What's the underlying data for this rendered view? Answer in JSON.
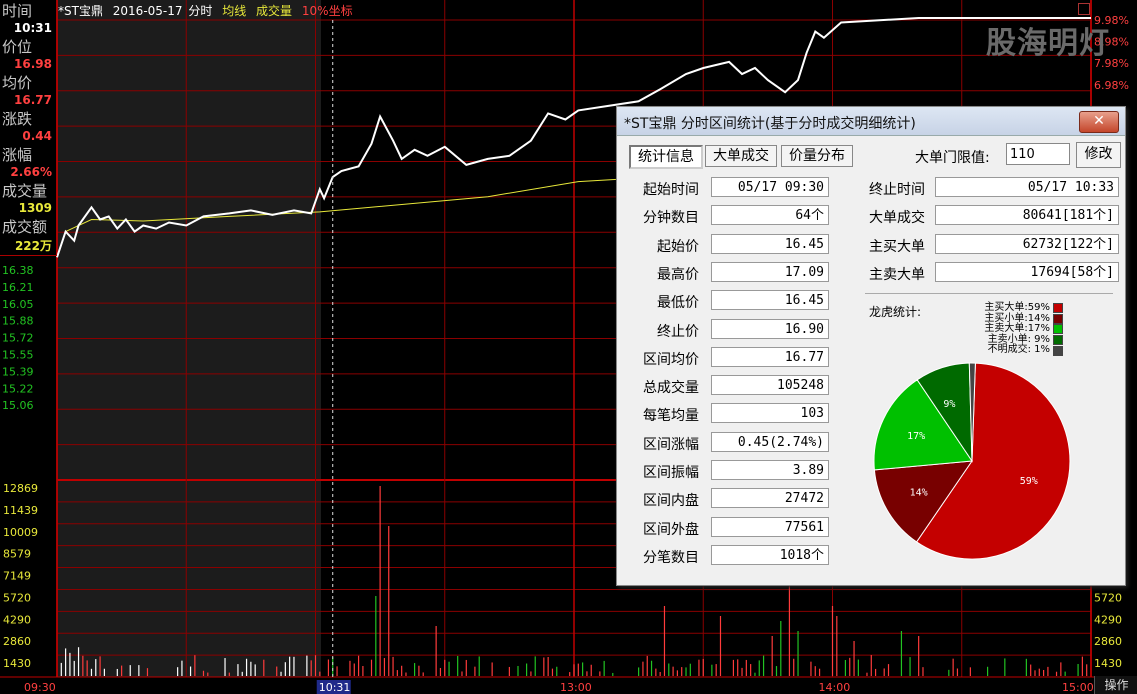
{
  "info_panel": {
    "time_label": "时间",
    "time_value": "10:31",
    "price_label": "价位",
    "price_value": "16.98",
    "avg_label": "均价",
    "avg_value": "16.77",
    "change_label": "涨跌",
    "change_value": "0.44",
    "pct_label": "涨幅",
    "pct_value": "2.66%",
    "vol_label": "成交量",
    "vol_value": "1309",
    "amount_label": "成交额",
    "amount_value": "222万"
  },
  "header": {
    "stock": "*ST宝鼎",
    "date": "2016-05-17",
    "mode": "分时",
    "avg_line": "均线",
    "volume": "成交量",
    "coord": "10%坐标"
  },
  "watermark": "股海明灯",
  "footer": {
    "operate_button": "操作"
  },
  "colors": {
    "up": "#ff3b3b",
    "down": "#22c322",
    "grid": "#8a0000",
    "avg": "#e8e83a",
    "price": "#ffffff"
  },
  "chart_data": {
    "type": "line",
    "title": "*ST宝鼎 2016-05-17 分时",
    "price_ticks_left": [
      "16.38",
      "16.21",
      "16.05",
      "15.88",
      "15.72",
      "15.55",
      "15.39",
      "15.22",
      "15.06"
    ],
    "price_ticks_right": [
      "9.98%",
      "8.98%",
      "7.98%",
      "6.98%"
    ],
    "volume_ticks": [
      "12869",
      "11439",
      "10009",
      "8579",
      "7149",
      "5720",
      "4290",
      "2860",
      "1430"
    ],
    "time_ticks": [
      "09:30",
      "10:31",
      "13:00",
      "14:00",
      "15:00"
    ],
    "ylim": [
      14.98,
      18.03
    ],
    "cursor_time": "10:31",
    "price_series": [
      {
        "t": 0,
        "p": 16.45
      },
      {
        "t": 2,
        "p": 16.62
      },
      {
        "t": 4,
        "p": 16.56
      },
      {
        "t": 5,
        "p": 16.66
      },
      {
        "t": 8,
        "p": 16.78
      },
      {
        "t": 10,
        "p": 16.7
      },
      {
        "t": 12,
        "p": 16.72
      },
      {
        "t": 14,
        "p": 16.64
      },
      {
        "t": 16,
        "p": 16.7
      },
      {
        "t": 18,
        "p": 16.62
      },
      {
        "t": 20,
        "p": 16.66
      },
      {
        "t": 23,
        "p": 16.64
      },
      {
        "t": 26,
        "p": 16.68
      },
      {
        "t": 30,
        "p": 16.66
      },
      {
        "t": 34,
        "p": 16.72
      },
      {
        "t": 40,
        "p": 16.74
      },
      {
        "t": 45,
        "p": 16.76
      },
      {
        "t": 50,
        "p": 16.73
      },
      {
        "t": 55,
        "p": 16.76
      },
      {
        "t": 59,
        "p": 16.74
      },
      {
        "t": 61,
        "p": 16.9
      },
      {
        "t": 62,
        "p": 16.84
      },
      {
        "t": 64,
        "p": 16.98
      },
      {
        "t": 66,
        "p": 17.02
      },
      {
        "t": 70,
        "p": 17.05
      },
      {
        "t": 73,
        "p": 17.2
      },
      {
        "t": 75,
        "p": 17.38
      },
      {
        "t": 78,
        "p": 17.22
      },
      {
        "t": 80,
        "p": 17.1
      },
      {
        "t": 83,
        "p": 17.16
      },
      {
        "t": 86,
        "p": 17.12
      },
      {
        "t": 90,
        "p": 17.18
      },
      {
        "t": 95,
        "p": 17.06
      },
      {
        "t": 100,
        "p": 17.1
      },
      {
        "t": 105,
        "p": 17.12
      },
      {
        "t": 110,
        "p": 17.22
      },
      {
        "t": 114,
        "p": 17.4
      },
      {
        "t": 118,
        "p": 17.36
      },
      {
        "t": 121,
        "p": 17.42
      },
      {
        "t": 135,
        "p": 17.48
      },
      {
        "t": 140,
        "p": 17.56
      },
      {
        "t": 146,
        "p": 17.66
      },
      {
        "t": 150,
        "p": 17.7
      },
      {
        "t": 156,
        "p": 17.74
      },
      {
        "t": 159,
        "p": 17.66
      },
      {
        "t": 162,
        "p": 17.7
      },
      {
        "t": 165,
        "p": 17.62
      },
      {
        "t": 169,
        "p": 17.54
      },
      {
        "t": 172,
        "p": 17.62
      },
      {
        "t": 174,
        "p": 17.8
      },
      {
        "t": 176,
        "p": 17.94
      },
      {
        "t": 178,
        "p": 17.9
      },
      {
        "t": 182,
        "p": 18.0
      },
      {
        "t": 200,
        "p": 18.03
      },
      {
        "t": 240,
        "p": 18.03
      }
    ],
    "avg_series": [
      {
        "t": 2,
        "p": 16.62
      },
      {
        "t": 8,
        "p": 16.7
      },
      {
        "t": 20,
        "p": 16.69
      },
      {
        "t": 40,
        "p": 16.72
      },
      {
        "t": 61,
        "p": 16.75
      },
      {
        "t": 100,
        "p": 16.85
      },
      {
        "t": 121,
        "p": 16.95
      },
      {
        "t": 170,
        "p": 17.03
      },
      {
        "t": 240,
        "p": 17.05
      }
    ]
  },
  "dialog": {
    "title": "*ST宝鼎 分时区间统计(基于分时成交明细统计)",
    "close": "✕",
    "tabs": [
      "统计信息",
      "大单成交",
      "价量分布"
    ],
    "threshold_label": "大单门限值:",
    "threshold_value": "110",
    "edit_button": "修改",
    "left_rows": [
      {
        "label": "起始时间",
        "value": "05/17 09:30"
      },
      {
        "label": "分钟数目",
        "value": "64个"
      },
      {
        "label": "起始价",
        "value": "16.45"
      },
      {
        "label": "最高价",
        "value": "17.09"
      },
      {
        "label": "最低价",
        "value": "16.45"
      },
      {
        "label": "终止价",
        "value": "16.90"
      },
      {
        "label": "区间均价",
        "value": "16.77"
      },
      {
        "label": "总成交量",
        "value": "105248"
      },
      {
        "label": "每笔均量",
        "value": "103"
      },
      {
        "label": "区间涨幅",
        "value": "0.45(2.74%)"
      },
      {
        "label": "区间振幅",
        "value": "3.89"
      },
      {
        "label": "区间内盘",
        "value": "27472"
      },
      {
        "label": "区间外盘",
        "value": "77561"
      },
      {
        "label": "分笔数目",
        "value": "1018个"
      }
    ],
    "right_rows": [
      {
        "label": "终止时间",
        "value": "05/17 10:33"
      },
      {
        "label": "大单成交",
        "value": "80641[181个]"
      },
      {
        "label": "主买大单",
        "value": "62732[122个]"
      },
      {
        "label": "主卖大单",
        "value": "17694[58个]"
      }
    ],
    "pie_title": "龙虎统计:",
    "pie": [
      {
        "name": "主买大单",
        "pct": 59,
        "color": "#c40000",
        "legend": "主买大单:59%"
      },
      {
        "name": "主买小单",
        "pct": 14,
        "color": "#780000",
        "legend": "主买小单:14%"
      },
      {
        "name": "主卖大单",
        "pct": 17,
        "color": "#00c000",
        "legend": "主卖大单:17%"
      },
      {
        "name": "主卖小单",
        "pct": 9,
        "color": "#006a00",
        "legend": "主卖小单: 9%"
      },
      {
        "name": "不明成交",
        "pct": 1,
        "color": "#444444",
        "legend": "不明成交: 1%"
      }
    ],
    "pie_labels": [
      "59%",
      "14%",
      "17%",
      "9%"
    ]
  }
}
